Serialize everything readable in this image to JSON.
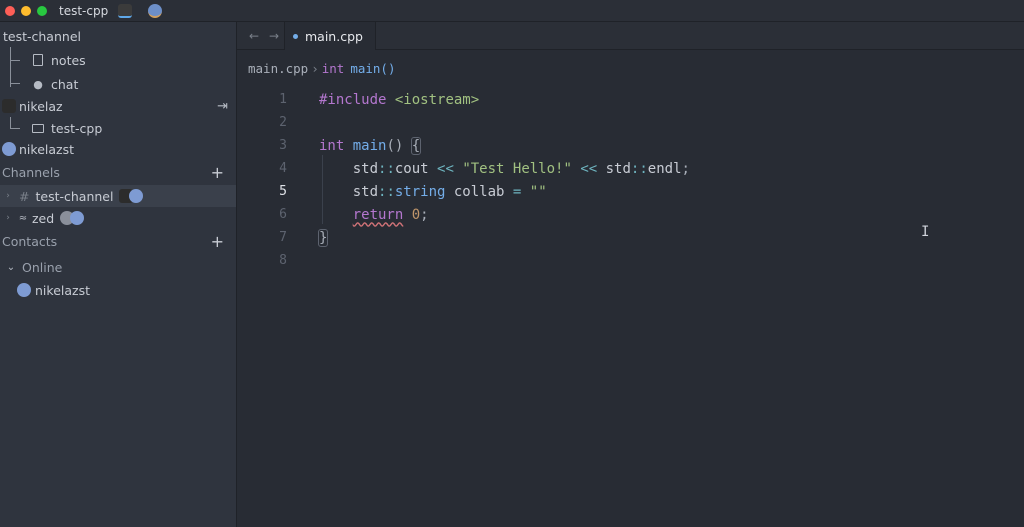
{
  "titlebar": {
    "project": "test-cpp"
  },
  "sidebar": {
    "root_channel": "test-channel",
    "items": {
      "notes": "notes",
      "chat": "chat",
      "user1": "nikelaz",
      "project": "test-cpp",
      "user2": "nikelazst"
    },
    "channels_heading": "Channels",
    "channels": [
      {
        "name": "test-channel",
        "prefix": "#"
      },
      {
        "name": "zed"
      }
    ],
    "contacts_heading": "Contacts",
    "online_heading": "Online",
    "contact": "nikelazst"
  },
  "tabs": [
    {
      "label": "main.cpp",
      "active": true
    }
  ],
  "breadcrumb": {
    "file": "main.cpp",
    "sep": "›",
    "kw": "int",
    "fn": "main()"
  },
  "editor": {
    "line_numbers": [
      "1",
      "2",
      "3",
      "4",
      "5",
      "6",
      "7",
      "8"
    ],
    "active_line": 5
  },
  "icons": {
    "back": "arrow-left-icon",
    "forward": "arrow-right-icon",
    "file": "file-icon",
    "chat": "chat-bubble-icon",
    "folder": "folder-icon",
    "leave": "leave-call-icon",
    "add": "plus-icon",
    "chevron": "chevron-icon"
  },
  "colors": {
    "accent": "#74ade8",
    "keyword": "#b477cf",
    "string": "#a1c181",
    "number": "#bf956a"
  }
}
